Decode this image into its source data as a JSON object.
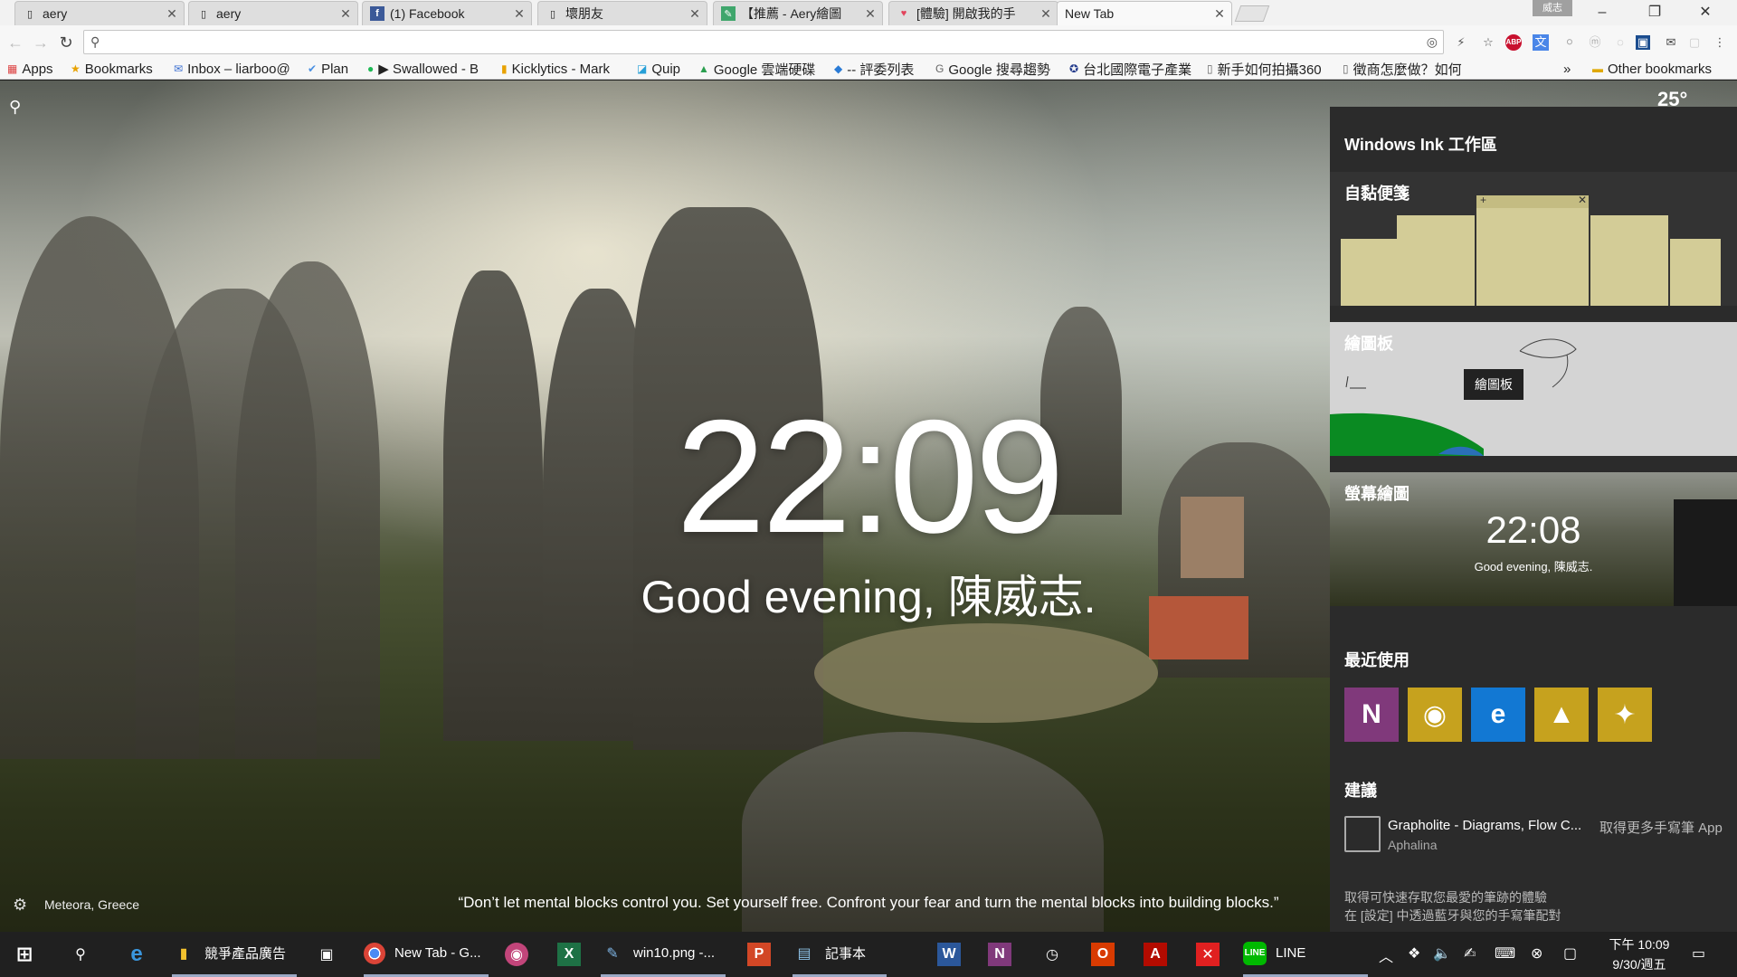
{
  "browser": {
    "tabs": [
      {
        "title": "aery"
      },
      {
        "title": "aery"
      },
      {
        "title": "(1) Facebook"
      },
      {
        "title": "壞朋友"
      },
      {
        "title": "【推薦 - Aery繪圖"
      },
      {
        "title": "[體驗] 開啟我的手"
      },
      {
        "title": "New Tab"
      }
    ],
    "profile_name": "威志",
    "omnibox": {
      "value": "",
      "placeholder": ""
    },
    "bookmarks": [
      {
        "label": "Apps",
        "icon": "apps-grid-icon"
      },
      {
        "label": "Bookmarks",
        "icon": "star-icon"
      },
      {
        "label": "Inbox – liarboo@",
        "icon": "inbox-icon"
      },
      {
        "label": "Plan",
        "icon": "check-icon"
      },
      {
        "label": "▶ Swallowed - B",
        "icon": "spotify-icon"
      },
      {
        "label": "Kicklytics - Mark",
        "icon": "bar-chart-icon"
      },
      {
        "label": "Quip",
        "icon": "quip-icon"
      },
      {
        "label": "Google 雲端硬碟",
        "icon": "drive-icon"
      },
      {
        "label": "-- 評委列表",
        "icon": "diamond-icon"
      },
      {
        "label": "Google 搜尋趨勢",
        "icon": "google-icon"
      },
      {
        "label": "台北國際電子產業",
        "icon": "globe-icon"
      },
      {
        "label": "新手如何拍攝360",
        "icon": "page-icon"
      },
      {
        "label": "徵商怎麼做？如何",
        "icon": "page-icon"
      }
    ],
    "other_bookmarks": "Other bookmarks",
    "more_bookmarks": "»"
  },
  "newtab": {
    "clock": "22:09",
    "greeting": "Good evening, 陳威志.",
    "weather": "25°",
    "location": "Meteora, Greece",
    "quote": "“Don’t let mental blocks control you. Set yourself free. Confront your fear and turn the mental blocks into building blocks.”"
  },
  "ink": {
    "title": "Windows Ink 工作區",
    "sticky_notes": "自黏便箋",
    "sketchpad": "繪圖板",
    "sketchpad_tooltip": "繪圖板",
    "screen_sketch": "螢幕繪圖",
    "screen_sketch_clock": "22:08",
    "screen_sketch_greeting": "Good evening, 陳威志.",
    "recent": "最近使用",
    "recent_apps": [
      {
        "name": "OneNote",
        "icon": "onenote-icon",
        "color": "#80397b"
      },
      {
        "name": "Maps",
        "icon": "map-pin-icon",
        "color": "#c6a21e"
      },
      {
        "name": "Edge",
        "icon": "edge-icon",
        "color": "#1278d3"
      },
      {
        "name": "Photos",
        "icon": "photos-icon",
        "color": "#c6a21e"
      },
      {
        "name": "Tips",
        "icon": "lightbulb-icon",
        "color": "#c6a21e"
      }
    ],
    "suggestions": "建議",
    "suggestion_app": "Grapholite - Diagrams, Flow C...",
    "suggestion_publisher": "Aphalina",
    "more_apps": "取得更多手寫筆 App",
    "footer_line1": "取得可快速存取您最愛的筆跡的體驗",
    "footer_line2": "在 [設定] 中透過藍牙與您的手寫筆配對"
  },
  "taskbar": {
    "items": [
      {
        "label": "",
        "icon": "edge-icon"
      },
      {
        "label": "競爭產品廣告",
        "icon": "folder-icon"
      },
      {
        "label": "",
        "icon": "store-icon"
      },
      {
        "label": "New Tab - G...",
        "icon": "chrome-icon"
      },
      {
        "label": "",
        "icon": "app-icon"
      },
      {
        "label": "",
        "icon": "excel-icon"
      },
      {
        "label": "win10.png -...",
        "icon": "paint-icon"
      },
      {
        "label": "",
        "icon": "powerpoint-icon"
      },
      {
        "label": "記事本",
        "icon": "notepad-icon"
      },
      {
        "label": "",
        "icon": "word-icon"
      },
      {
        "label": "",
        "icon": "onenote-icon"
      },
      {
        "label": "",
        "icon": "alarm-icon"
      },
      {
        "label": "",
        "icon": "office-icon"
      },
      {
        "label": "",
        "icon": "acrobat-icon"
      },
      {
        "label": "",
        "icon": "xmind-icon"
      },
      {
        "label": "LINE",
        "icon": "line-icon"
      }
    ],
    "time": "下午 10:09",
    "date": "9/30/週五"
  }
}
